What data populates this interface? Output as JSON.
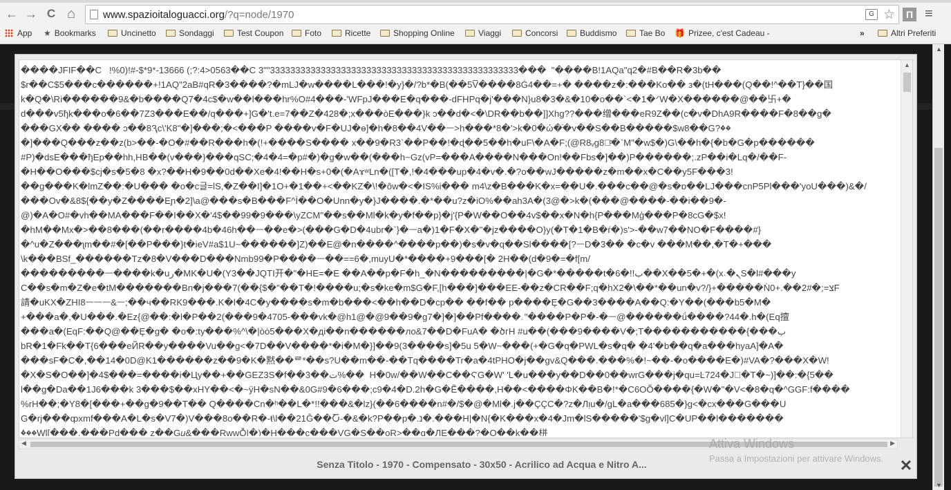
{
  "toolbar": {
    "back": "←",
    "forward": "→",
    "reload": "C",
    "home": "⌂",
    "url_host": "www.spazioitaloguacci.org",
    "url_path": "/?q=node/1970",
    "translate": "G",
    "star": "☆",
    "extension": "Π",
    "menu": "≡"
  },
  "bookmarks": {
    "apps": "App",
    "items": [
      "Bookmarks",
      "Uncinetto",
      "Sondaggi",
      "Test Coupon",
      "Foto",
      "Ricette",
      "Shopping Online",
      "Viaggi",
      "Concorsi",
      "Buddismo",
      "Tae Bo",
      "Prizee, c'est Cadeau -"
    ],
    "overflow": "»",
    "other": "Altri Preferiti"
  },
  "lightbox": {
    "lines": [
      "����JFIF��C   !%0)!#-$*9*-13666 (;?:4>0563��C 3\"\"3333333333333333333333333333333333333333333333333���  \"����B!1AQa\"q2�#B��R�3b��",
      "$r��C$5���c������+!1AQ\"2aB#qR�3����?�mLJ�w����L���!�y}�/?b*�B(��5V̅����8Ġ4��=+� ����z�:���Ko�� з�(tH���(Q��!^��T}��国",
      "k�Q�\\Ri������9&�b����Q7�4c$�w��l���hr%O#4���-'WFpJ���E�q���-dFHPq�j'���N}u8�3�&�10�o��`<�1�ᐟW�X������@��卐+�",
      "d���v5ђk���o�6��7Z3���E��/q���+]G�'t.e=7��Z�428�;x���òE���}k ɔ��d�<�\\DR��b��]]Xhg??���缯���eR9Z��(c�v�DhA9R����F�8��g�",
      "���GX�� ���� ͻ��8Ԇc\\'K8\"�]���;�<���P ����v�F�UJ�ɵ]�h�8��4V��ᅳ>h���*8�'>k�0�ώ�ֿ�v��S��B�����$w8��G?ۢ��",
      "�]���Q���z��z(b>��-�O�#��R���h�(!+����S���� x��9�R3`��P��!�ɖ��5��h�uF\\�A�F;(@R8ᵥg8�ͦ�`M\"�w$�)G\\��h�{�b�G�p������",
      "#P)�dsE���ђEp��hh,HB��(v���}���qSC;�4�4=�p#�)�g�w��(���h~Gz(vP=���A����N���On!��Fbs�]��)P������;.zP��i�Lq�/��F-",
      "�H��O���$cj�s�5�8 �x?��H�9��0d��Xe�4!��H�s+0�(�AɤʷLn�([T�,!�4���up�4�v�.�?o��wJ�����z�m��x�C��y5F���3!",
      "��g���K�lmZ��:�U��� �o�c글=lS,�Z��I]�1O+�1��+<��KZ�\\!�ôw�<�IS%i��� m4\\z�B���K�x=��U�.���c��@�s�ɒ��LJ���cnP5Pl���'yoU���)&�/",
      "���Ov�&8${��y�Z����Eɲ�2]\\a@���s�B���F^Ì��O�Unn�y�}J����.�*��u?z�iO%��ah3A�(3@�>k�(���@����-��i��9�-",
      "@)�A�O#�vh��MA���F��I��X�'4$��99�9���\\yZCM\"��s��Ml�k�y�f��p}�j'{P�W��O��4v$��x�N�h{P���Mģ���P�8cG�$x!",
      "�hM��Mx�>��8���(��r����4b�46h��ᅳ��e�>(���G�D�4ubr�`}�ᅳa�)1�F�X�\"�jz����O}y(�T�1�B�ŕ�)s'>-��w7��NO�F����#}",
      "�^u�Z���ʅm��#�[��P���}t�ieV#a$1U~������]Z)��E@�n����^����p��)�s�v�q��Sl����[?ᅳD�3�� �c�v ���M��,�T�+���",
      "\\k���BSf_������Tz�8�V���D���Nmb99�P����ᅳ��==6�,muyU�*����+9���[� 2H��(d�9�=�f[m/",
      "���������ᅳ����k�uر�MK�U�(Y3��JQTI开�\"�HE=�E ��A��p�F�h_�N���������|�G�*�����t�6�!!ب��X��5�+�(x˓�ܢS�l#���y",
      "C��s�m�Z�e�tM�������Bn�j���7(��{$�\"��T�!����u;�s�ke�m$G�F,[h���]���EE-��z�CR��F;q�hX2�\\��*��un�v?/}+�����Ǹ0+.��2#�;=צF",
      "請�uKX�ZHI8ᅳᅳᅳ&ᅳ;��ч��RK9���.K�l�4C�y����s�m�b���<��h��D�cp�� ��f�� p����Ȩ�G��3����A��Q:�Y��(���b5�M�",
      "+���a�,�U���.�Ez{@��:�l�P��2(���9�4705-���vk�@h1@�@9��9�g7�]�]��Pf����ۦ\"����P�P�-�ᅳ@������ǘ����?44�.h�(Eq擅",
      "���a�(EqF:��Q@��Ȩ�g� �o�:ty���%^\\�|òȯ5���X�дi��n������лo&7��D�FuA� �ծгH #u��(���9����V�;T�����������{���ب",
      "bR�1�Fk��T{6���eЙR��y����Vu��g<�7D��V����*�i�M�}]��9(3����s]�5u 5�W~���(+�G�q�PWL�s�q� �4'�b��q�a���hyaA]�A�",
      "���sF�C�,��14�0D@K1������z��9�K�黙��ᄅ*��s?U��m��-��Tq����Tr�a�4tPHO�j��gv&Q���.���%�!~��-�o����E�)#VA�?���X�W!",
      "�X�S�O��]�4$���=����i�Цy��+��GEZ3S�f��3��ت%��  H�0w/��W��C��ϚG�W' 'L�u���y��D��0��wrG���j�qu=Ŀ724�J⃝�T�~)]��:�{5��",
      "l��g�Da��1J6���k 3���$��xΗY��<�~ÿH�sN��&0G#9�6���;c9�4�D.2h�G�Ẽ����,H��<����ΦK��B�!*�C6OÕ����{�W�\"�V<�8�q�^GGF:f����",
      "%rH��;�Y8�[���+��g�9��T�� Q����Cn�ʰ��L�*!!���&�lz}(��6����n#�/$�@�Ml�.j��ÇÇC�?z�Лᴉu�/gL�a���685�}g<�cx���G���U",
      "G�rj���ȹxmf���A�L�s�V7�)V���8o��R�-ŧ\\l��21Ğ��Ⴀ-�&�k?P��p�.נ�.���H|�N{�K���x�4�Jm�lS�����'$g�vl]C�UP��l�������",
      "�ۨ��Wl[���,���Pd��� z��G𝑢&���RwwỖ|�)�H���c���VG�S��oR>��g�ЛE���?�O��k��栟"
    ],
    "caption": "Senza Titolo - 1970 - Compensato - 30x50 - Acrilico ad Acqua e Nitro A...",
    "close": "✕"
  },
  "watermark": {
    "title": "Attiva Windows",
    "subtitle": "Passa a Impostazioni per attivare Windows."
  },
  "colors": {
    "overlay": "#191919",
    "browser_chrome": "#f2f2f2"
  }
}
